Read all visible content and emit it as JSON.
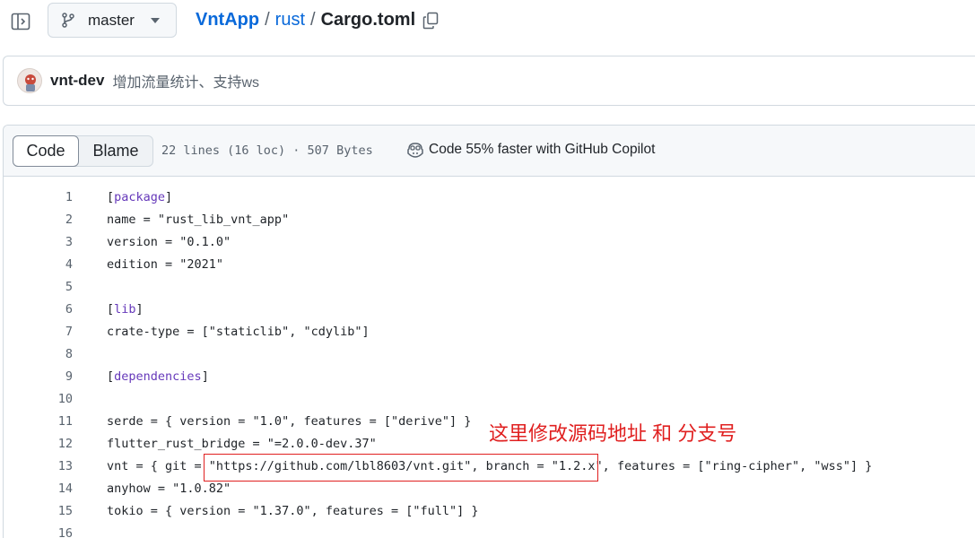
{
  "header": {
    "branch": "master",
    "breadcrumb": {
      "repo": "VntApp",
      "sep1": "/",
      "folder": "rust",
      "sep2": "/",
      "file": "Cargo.toml"
    }
  },
  "commit": {
    "author": "vnt-dev",
    "message": "增加流量统计、支持ws"
  },
  "file_header": {
    "tab_code": "Code",
    "tab_blame": "Blame",
    "meta": "22 lines (16 loc) · 507 Bytes",
    "copilot": "Code 55% faster with GitHub Copilot"
  },
  "code_lines": [
    {
      "n": "1",
      "text": "",
      "section": "[package]"
    },
    {
      "n": "2",
      "text": "name = \"rust_lib_vnt_app\""
    },
    {
      "n": "3",
      "text": "version = \"0.1.0\""
    },
    {
      "n": "4",
      "text": "edition = \"2021\""
    },
    {
      "n": "5",
      "text": ""
    },
    {
      "n": "6",
      "text": "",
      "section": "[lib]"
    },
    {
      "n": "7",
      "text": "crate-type = [\"staticlib\", \"cdylib\"]"
    },
    {
      "n": "8",
      "text": ""
    },
    {
      "n": "9",
      "text": "",
      "section": "[dependencies]"
    },
    {
      "n": "10",
      "text": ""
    },
    {
      "n": "11",
      "text": "serde = { version = \"1.0\", features = [\"derive\"] }"
    },
    {
      "n": "12",
      "text": "flutter_rust_bridge = \"=2.0.0-dev.37\""
    },
    {
      "n": "13",
      "text": "vnt = { git = \"https://github.com/lbl8603/vnt.git\", branch = \"1.2.x\", features = [\"ring-cipher\", \"wss\"] }"
    },
    {
      "n": "14",
      "text": "anyhow = \"1.0.82\""
    },
    {
      "n": "15",
      "text": "tokio = { version = \"1.37.0\", features = [\"full\"] }"
    },
    {
      "n": "16",
      "text": ""
    }
  ],
  "annotation": {
    "text": "这里修改源码地址  和 分支号"
  },
  "colors": {
    "link": "#0969da",
    "section": "#6639ba",
    "annotation": "#e02020"
  }
}
